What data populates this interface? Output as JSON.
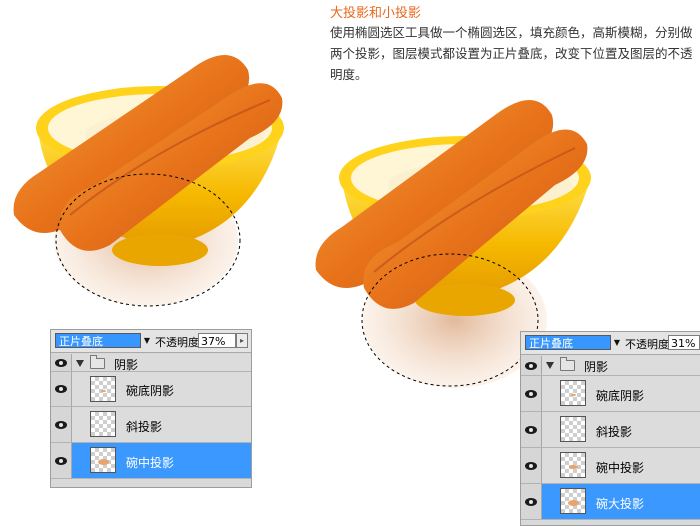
{
  "tutorial": {
    "title": "大投影和小投影",
    "description": "使用椭圆选区工具做一个椭圆选区，填充颜色，高斯模糊，分别做两个投影，图层模式都设置为正片叠底，改变下位置及图层的不透明度。"
  },
  "panel_left": {
    "blend_mode": "正片叠底",
    "opacity_label": "不透明度:",
    "opacity_value": "37%",
    "group_name": "阴影",
    "layers": [
      {
        "name": "碗底阴影",
        "selected": false
      },
      {
        "name": "斜投影",
        "selected": false
      },
      {
        "name": "碗中投影",
        "selected": true
      }
    ]
  },
  "panel_right": {
    "blend_mode": "正片叠底",
    "opacity_label": "不透明度:",
    "opacity_value": "31%",
    "group_name": "阴影",
    "layers": [
      {
        "name": "碗底阴影",
        "selected": false
      },
      {
        "name": "斜投影",
        "selected": false
      },
      {
        "name": "碗中投影",
        "selected": false
      },
      {
        "name": "碗大投影",
        "selected": true
      }
    ]
  },
  "colors": {
    "title_orange": "#e8671e",
    "selection_blue": "#3a98fe",
    "bowl_yellow": "#f5b800",
    "youtiao_orange": "#e8731a"
  }
}
